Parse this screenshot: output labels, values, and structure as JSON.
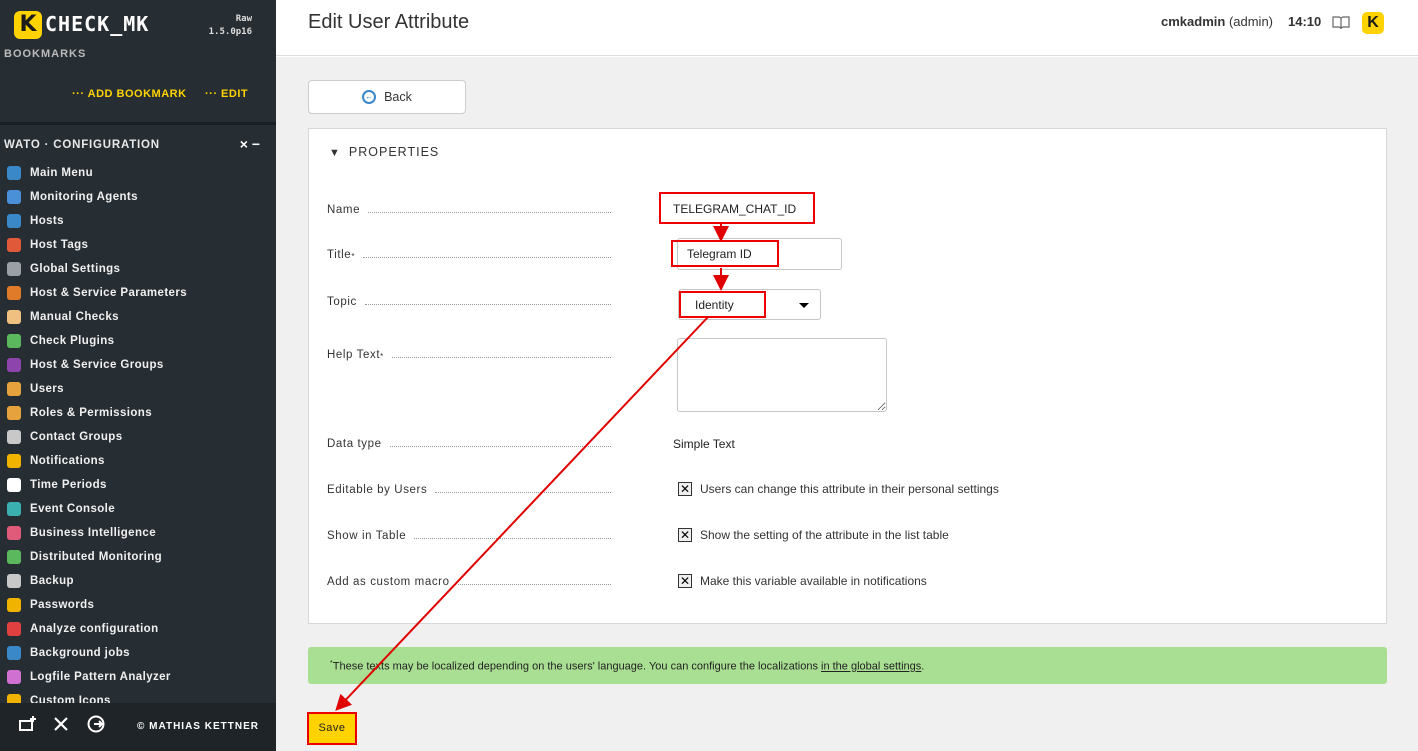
{
  "app": {
    "logo_letter": "K",
    "logo_text": "CHECK_MK",
    "edition": "Raw",
    "version": "1.5.0p16"
  },
  "sidebar": {
    "bookmarks_title": "BOOKMARKS",
    "add_bookmark": "··· ADD BOOKMARK",
    "edit": "··· EDIT",
    "wato_title": "WATO · CONFIGURATION",
    "wato_controls": "× −",
    "items": [
      {
        "label": "Main Menu",
        "icon": "main-menu-icon",
        "color": "#3a88c8"
      },
      {
        "label": "Monitoring Agents",
        "icon": "agents-icon",
        "color": "#4a90d9"
      },
      {
        "label": "Hosts",
        "icon": "hosts-icon",
        "color": "#3a88c8"
      },
      {
        "label": "Host Tags",
        "icon": "tag-icon",
        "color": "#e05a3a"
      },
      {
        "label": "Global Settings",
        "icon": "gear-icon",
        "color": "#9aa0a6"
      },
      {
        "label": "Host & Service Parameters",
        "icon": "parameters-icon",
        "color": "#e07b2a"
      },
      {
        "label": "Manual Checks",
        "icon": "hand-icon",
        "color": "#f0c080"
      },
      {
        "label": "Check Plugins",
        "icon": "puzzle-icon",
        "color": "#5cb85c"
      },
      {
        "label": "Host & Service Groups",
        "icon": "groups-icon",
        "color": "#8e44ad"
      },
      {
        "label": "Users",
        "icon": "users-icon",
        "color": "#e6a23c"
      },
      {
        "label": "Roles & Permissions",
        "icon": "roles-icon",
        "color": "#e6a23c"
      },
      {
        "label": "Contact Groups",
        "icon": "contact-groups-icon",
        "color": "#c8c8c8"
      },
      {
        "label": "Notifications",
        "icon": "bell-icon",
        "color": "#f0b400"
      },
      {
        "label": "Time Periods",
        "icon": "clock-icon",
        "color": "#ffffff"
      },
      {
        "label": "Event Console",
        "icon": "event-console-icon",
        "color": "#3ab0b0"
      },
      {
        "label": "Business Intelligence",
        "icon": "bi-icon",
        "color": "#e05a7a"
      },
      {
        "label": "Distributed Monitoring",
        "icon": "globe-icon",
        "color": "#5cb85c"
      },
      {
        "label": "Backup",
        "icon": "backup-icon",
        "color": "#c8c8c8"
      },
      {
        "label": "Passwords",
        "icon": "key-icon",
        "color": "#f0b400"
      },
      {
        "label": "Analyze configuration",
        "icon": "heart-icon",
        "color": "#e04040"
      },
      {
        "label": "Background jobs",
        "icon": "list-icon",
        "color": "#3a88c8"
      },
      {
        "label": "Logfile Pattern Analyzer",
        "icon": "flask-icon",
        "color": "#d070d0"
      },
      {
        "label": "Custom Icons",
        "icon": "custom-icons-icon",
        "color": "#f0b400"
      }
    ],
    "footer": {
      "copyright": "© MATHIAS KETTNER"
    }
  },
  "topbar": {
    "page_title": "Edit User Attribute",
    "user_name": "cmkadmin",
    "user_role": "(admin)",
    "time": "14:10"
  },
  "back_button": "Back",
  "properties": {
    "header": "PROPERTIES",
    "name_label": "Name",
    "name_value": "TELEGRAM_CHAT_ID",
    "title_label": "Title",
    "title_value": "Telegram ID",
    "topic_label": "Topic",
    "topic_value": "Identity",
    "help_label": "Help Text",
    "help_value": "",
    "datatype_label": "Data type",
    "datatype_value": "Simple Text",
    "editable_label": "Editable by Users",
    "editable_text": "Users can change this attribute in their personal settings",
    "editable_checked": true,
    "showtable_label": "Show in Table",
    "showtable_text": "Show the setting of the attribute in the list table",
    "showtable_checked": true,
    "macro_label": "Add as custom macro",
    "macro_text": "Make this variable available in notifications",
    "macro_checked": true,
    "required_marker": "*"
  },
  "note": {
    "marker": "*",
    "text": "These texts may be localized depending on the users' language. You can configure the localizations ",
    "link": "in the global settings",
    "end": "."
  },
  "save_button": "Save",
  "colors": {
    "sidebar_bg": "#262d33",
    "accent_yellow": "#ffd200",
    "note_green": "#a9df92",
    "annotation_red": "#e00000"
  }
}
